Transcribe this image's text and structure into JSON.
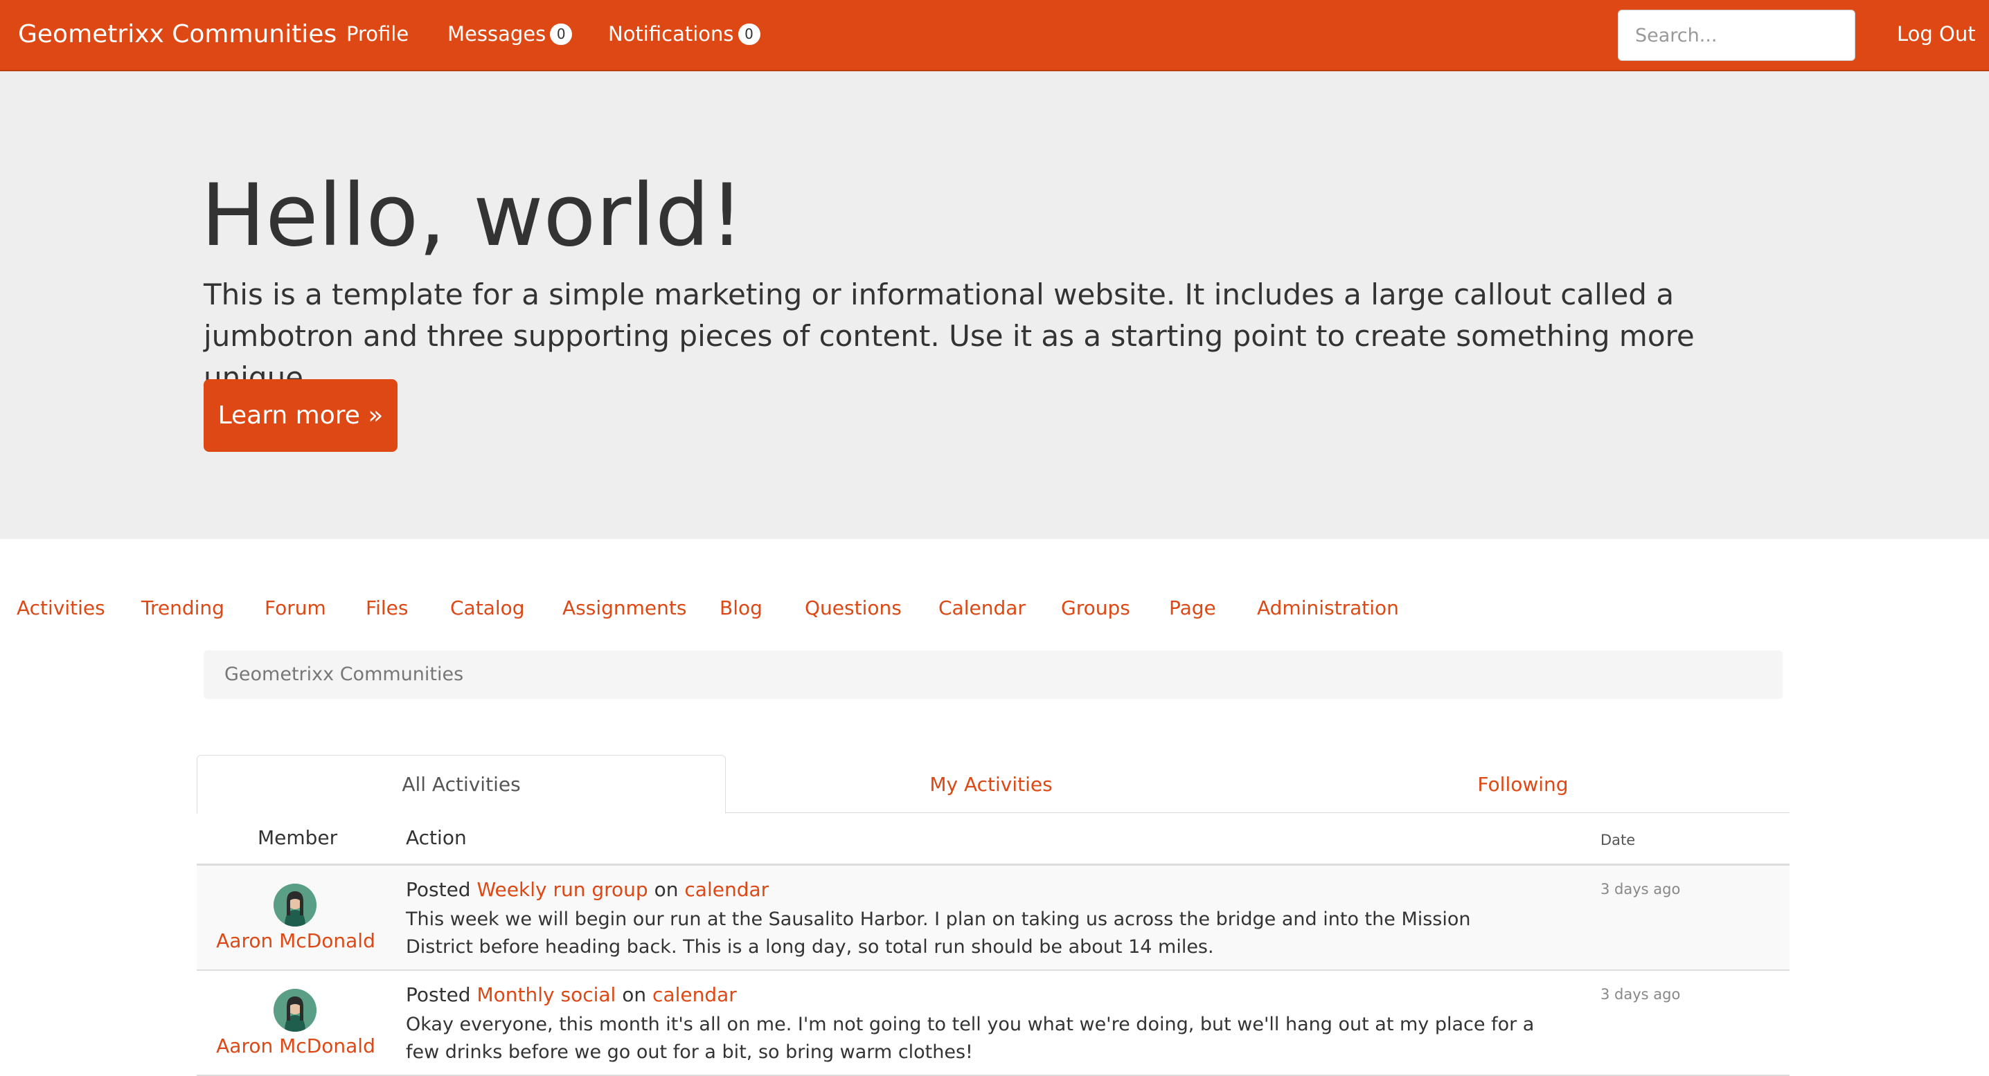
{
  "navbar": {
    "brand": "Geometrixx Communities",
    "profile_label": "Profile",
    "messages_label": "Messages",
    "messages_count": "0",
    "notifications_label": "Notifications",
    "notifications_count": "0",
    "search_placeholder": "Search...",
    "logout_label": "Log Out"
  },
  "jumbotron": {
    "title": "Hello, world!",
    "text": "This is a template for a simple marketing or informational website. It includes a large callout called a jumbotron and three supporting pieces of content. Use it as a starting point to create something more unique.",
    "button_label": "Learn more »"
  },
  "secondary_nav": [
    "Activities",
    "Trending",
    "Forum",
    "Files",
    "Catalog",
    "Assignments",
    "Blog",
    "Questions",
    "Calendar",
    "Groups",
    "Page",
    "Administration"
  ],
  "breadcrumb": "Geometrixx Communities",
  "tabs": [
    "All Activities",
    "My Activities",
    "Following"
  ],
  "table": {
    "headers": {
      "member": "Member",
      "action": "Action",
      "date": "Date"
    },
    "rows": [
      {
        "member": "Aaron McDonald",
        "verb": "Posted",
        "item": "Weekly run group",
        "preposition": "on",
        "target": "calendar",
        "body": "This week we will begin our run at the Sausalito Harbor. I plan on taking us across the bridge and into the Mission District before heading back. This is a long day, so total run should be about 14 miles.",
        "date": "3 days ago"
      },
      {
        "member": "Aaron McDonald",
        "verb": "Posted",
        "item": "Monthly social",
        "preposition": "on",
        "target": "calendar",
        "body": "Okay everyone, this month it's all on me. I'm not going to tell you what we're doing, but we'll hang out at my place for a few drinks before we go out for a bit, so bring warm clothes!",
        "date": "3 days ago"
      }
    ]
  },
  "colors": {
    "accent": "#dd4814",
    "jumbotron_bg": "#eeeeee",
    "stripe": "#f9f9f9"
  }
}
